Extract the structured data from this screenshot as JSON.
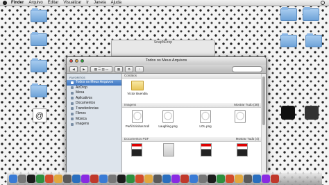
{
  "menubar": {
    "items": [
      "Finder",
      "Arquivo",
      "Editar",
      "Visualizar",
      "Ir",
      "Janela",
      "Ajuda"
    ]
  },
  "ghost_window": {
    "title": "SnapNDrop"
  },
  "finder": {
    "title": "Todos os Meus Arquivos",
    "sidebar": {
      "heading": "FAVORITOS",
      "items": [
        {
          "label": "Todos os Meus Arquivos",
          "icon": "all-files-icon"
        },
        {
          "label": "AirDrop",
          "icon": "airdrop-icon"
        },
        {
          "label": "Mesa",
          "icon": "desktop-icon"
        },
        {
          "label": "Aplicativos",
          "icon": "applications-icon"
        },
        {
          "label": "Documentos",
          "icon": "documents-icon"
        },
        {
          "label": "Transferências",
          "icon": "downloads-icon"
        },
        {
          "label": "Filmes",
          "icon": "movies-icon"
        },
        {
          "label": "Música",
          "icon": "music-icon"
        },
        {
          "label": "Imagens",
          "icon": "pictures-icon"
        }
      ]
    },
    "sections": {
      "contacts": {
        "heading": "Contatos",
        "files": [
          {
            "name": "Victor Buendia"
          }
        ]
      },
      "images": {
        "heading": "Imagens",
        "show_all": "Mostrar Tudo (38)",
        "files": [
          {
            "name": "Perfil tirinhas troll"
          },
          {
            "name": "Laughing.png"
          },
          {
            "name": "LOL.png"
          },
          {
            "name": ""
          }
        ]
      },
      "pdfs": {
        "heading": "Documentos PDF",
        "show_all": "Mostrar Tudo (4)"
      }
    }
  },
  "dock": {
    "apps": 30
  }
}
